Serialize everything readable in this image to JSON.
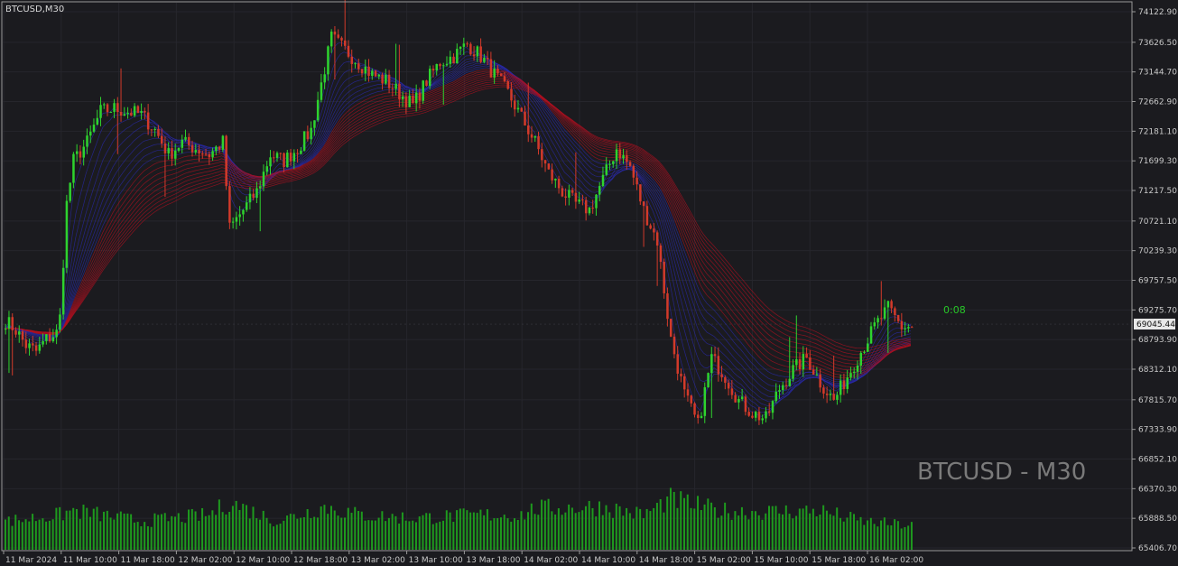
{
  "header": {
    "symbol_label": "BTCUSD,M30"
  },
  "watermark": {
    "text": "BTCUSD - M30"
  },
  "timer": {
    "text": "0:08"
  },
  "current_price": {
    "label": "69045.44",
    "value": 69045.44
  },
  "colors": {
    "background": "#1b1b1f",
    "bull": "#2ed32e",
    "bear": "#d23a2a",
    "ribbon_red": "#b01020",
    "ribbon_blue": "#2a2aa8",
    "volume": "#1e9a1e",
    "axis_text": "#c8c8c8",
    "price_tag_bg": "#e8e8e8"
  },
  "chart_data": {
    "type": "candlestick",
    "symbol": "BTCUSD",
    "timeframe": "M30",
    "y_ticks": [
      "74122.90",
      "73626.50",
      "73144.70",
      "72662.90",
      "72181.10",
      "71699.30",
      "71217.50",
      "70721.10",
      "70239.30",
      "69757.50",
      "69275.70",
      "68793.90",
      "68312.10",
      "67815.70",
      "67333.90",
      "66852.10",
      "66370.30",
      "65888.50",
      "65406.70"
    ],
    "ylim": [
      65406.7,
      74122.9
    ],
    "x_ticks": [
      "11 Mar 2024",
      "11 Mar 10:00",
      "11 Mar 18:00",
      "12 Mar 02:00",
      "12 Mar 10:00",
      "12 Mar 18:00",
      "13 Mar 02:00",
      "13 Mar 10:00",
      "13 Mar 18:00",
      "14 Mar 02:00",
      "14 Mar 10:00",
      "14 Mar 18:00",
      "15 Mar 02:00",
      "15 Mar 10:00",
      "15 Mar 18:00",
      "16 Mar 02:00"
    ],
    "close_path": [
      [
        0,
        69100
      ],
      [
        3,
        68950
      ],
      [
        6,
        68700
      ],
      [
        9,
        68600
      ],
      [
        12,
        68800
      ],
      [
        15,
        68900
      ],
      [
        16,
        69150
      ],
      [
        18,
        71000
      ],
      [
        20,
        71700
      ],
      [
        24,
        72000
      ],
      [
        28,
        72500
      ],
      [
        32,
        72550
      ],
      [
        36,
        72500
      ],
      [
        40,
        72450
      ],
      [
        44,
        72200
      ],
      [
        48,
        71800
      ],
      [
        52,
        72000
      ],
      [
        56,
        71900
      ],
      [
        60,
        71800
      ],
      [
        64,
        72000
      ],
      [
        66,
        70600
      ],
      [
        70,
        70900
      ],
      [
        74,
        71200
      ],
      [
        78,
        71800
      ],
      [
        82,
        71700
      ],
      [
        86,
        71900
      ],
      [
        90,
        72200
      ],
      [
        94,
        73200
      ],
      [
        96,
        73700
      ],
      [
        100,
        73500
      ],
      [
        104,
        73300
      ],
      [
        108,
        73100
      ],
      [
        112,
        73000
      ],
      [
        116,
        72800
      ],
      [
        120,
        72600
      ],
      [
        124,
        73000
      ],
      [
        128,
        73300
      ],
      [
        132,
        73400
      ],
      [
        136,
        73600
      ],
      [
        140,
        73400
      ],
      [
        144,
        73100
      ],
      [
        148,
        72800
      ],
      [
        152,
        72400
      ],
      [
        156,
        72000
      ],
      [
        160,
        71500
      ],
      [
        164,
        71200
      ],
      [
        168,
        71000
      ],
      [
        172,
        70900
      ],
      [
        176,
        71400
      ],
      [
        180,
        71900
      ],
      [
        184,
        71600
      ],
      [
        188,
        70900
      ],
      [
        192,
        70400
      ],
      [
        196,
        68800
      ],
      [
        200,
        67900
      ],
      [
        204,
        67400
      ],
      [
        208,
        68500
      ],
      [
        212,
        68200
      ],
      [
        216,
        67800
      ],
      [
        220,
        67600
      ],
      [
        224,
        67500
      ],
      [
        228,
        68000
      ],
      [
        232,
        68300
      ],
      [
        236,
        68500
      ],
      [
        240,
        68100
      ],
      [
        244,
        67800
      ],
      [
        248,
        68200
      ],
      [
        252,
        68600
      ],
      [
        256,
        69000
      ],
      [
        260,
        69300
      ],
      [
        264,
        69000
      ],
      [
        267,
        69000
      ]
    ],
    "volume_profile": [
      [
        0,
        0.45
      ],
      [
        16,
        0.55
      ],
      [
        20,
        0.62
      ],
      [
        40,
        0.45
      ],
      [
        60,
        0.55
      ],
      [
        66,
        0.75
      ],
      [
        80,
        0.45
      ],
      [
        94,
        0.68
      ],
      [
        104,
        0.55
      ],
      [
        120,
        0.5
      ],
      [
        140,
        0.55
      ],
      [
        152,
        0.55
      ],
      [
        156,
        0.65
      ],
      [
        176,
        0.68
      ],
      [
        188,
        0.55
      ],
      [
        196,
        0.8
      ],
      [
        210,
        0.62
      ],
      [
        224,
        0.6
      ],
      [
        240,
        0.62
      ],
      [
        252,
        0.45
      ],
      [
        267,
        0.38
      ]
    ],
    "n_candles": 268,
    "volume_max_label_free": true
  }
}
